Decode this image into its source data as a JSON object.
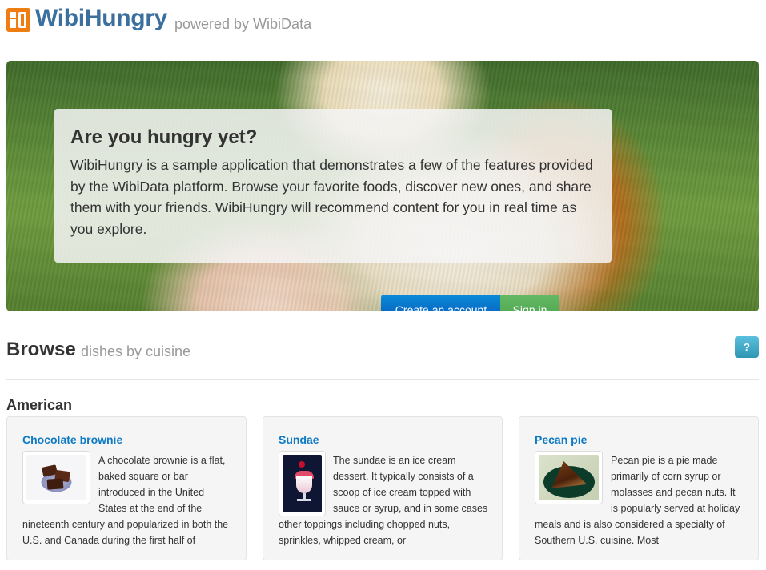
{
  "header": {
    "brand": "WibiHungry",
    "powered_by": "powered by WibiData",
    "logo_icon": "wibi-logo-icon",
    "logo_color": "#f07d12",
    "brand_color": "#3a6f9e"
  },
  "hero": {
    "title": "Are you hungry yet?",
    "description": "WibiHungry is a sample application that demonstrates a few of the features provided by the WibiData platform. Browse your favorite foods, discover new ones, and share them with your friends. WibiHungry will recommend content for you in real time as you explore.",
    "create_account_label": "Create an account",
    "sign_in_label": "Sign in"
  },
  "browse": {
    "title": "Browse",
    "subtitle": "dishes by cuisine",
    "help_label": "?"
  },
  "cuisines": [
    {
      "name": "American",
      "dishes": [
        {
          "title": "Chocolate brownie",
          "description": "A chocolate brownie is a flat, baked square or bar introduced in the United States at the end of the nineteenth century and popularized in both the U.S. and Canada during the first half of"
        },
        {
          "title": "Sundae",
          "description": "The sundae is an ice cream dessert. It typically consists of a scoop of ice cream topped with sauce or syrup, and in some cases other toppings including chopped nuts, sprinkles, whipped cream, or"
        },
        {
          "title": "Pecan pie",
          "description": "Pecan pie is a pie made primarily of corn syrup or molasses and pecan nuts. It is popularly served at holiday meals and is also considered a specialty of Southern U.S. cuisine. Most"
        }
      ]
    }
  ],
  "colors": {
    "link": "#0e7ac4",
    "primary_button": "#0554b8",
    "success_button": "#4a9f4a",
    "info_button": "#2f96b4"
  }
}
